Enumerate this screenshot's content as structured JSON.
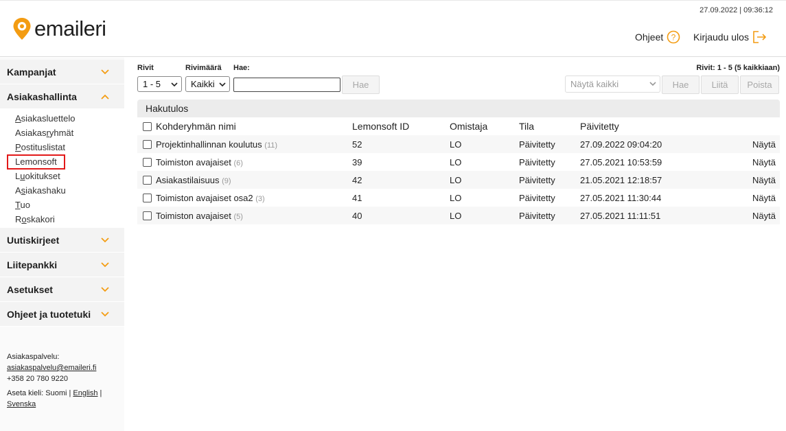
{
  "header": {
    "brand": "emaileri",
    "datetime": "27.09.2022 | 09:36:12",
    "help_label": "Ohjeet",
    "logout_label": "Kirjaudu ulos",
    "accent_color": "#f39c12"
  },
  "sidebar": {
    "sections": [
      {
        "label": "Kampanjat"
      },
      {
        "label": "Asiakashallinta"
      },
      {
        "label": "Uutiskirjeet"
      },
      {
        "label": "Liitepankki"
      },
      {
        "label": "Asetukset"
      },
      {
        "label": "Ohjeet ja tuotetuki"
      }
    ],
    "sub_items": [
      {
        "pre": "",
        "u": "A",
        "post": "siakasluettelo"
      },
      {
        "pre": "Asiakas",
        "u": "r",
        "post": "yhmät"
      },
      {
        "pre": "",
        "u": "P",
        "post": "ostituslistat"
      },
      {
        "pre": "",
        "u": "",
        "post": "Lemonsoft"
      },
      {
        "pre": "L",
        "u": "u",
        "post": "okitukset"
      },
      {
        "pre": "A",
        "u": "s",
        "post": "iakashaku"
      },
      {
        "pre": "",
        "u": "T",
        "post": "uo"
      },
      {
        "pre": "R",
        "u": "o",
        "post": "skakori"
      }
    ],
    "support": {
      "title": "Asiakaspalvelu:",
      "email": "asiakaspalvelu@emaileri.fi",
      "phone": "+358 20 780 9220",
      "lang_prefix": "Aseta kieli: Suomi |",
      "lang_en": "English",
      "lang_sep": "|",
      "lang_sv": "Svenska"
    }
  },
  "filters": {
    "rows_label": "Rivit",
    "rows_value": "1 - 5",
    "count_label": "Rivimäärä",
    "count_value": "Kaikki",
    "search_label": "Hae:",
    "search_value": "",
    "search_button": "Hae",
    "rows_info": "Rivit: 1 - 5 (5 kaikkiaan)",
    "show_select": "Näytä kaikki",
    "btn_hae": "Hae",
    "btn_liita": "Liitä",
    "btn_poista": "Poista"
  },
  "results": {
    "title": "Hakutulos",
    "columns": [
      "Kohderyhmän nimi",
      "Lemonsoft ID",
      "Omistaja",
      "Tila",
      "Päivitetty"
    ],
    "rows": [
      {
        "name": "Projektinhallinnan koulutus",
        "count": "(11)",
        "id": "52",
        "owner": "LO",
        "status": "Päivitetty",
        "updated": "27.09.2022 09:04:20",
        "action": "Näytä"
      },
      {
        "name": "Toimiston avajaiset",
        "count": "(6)",
        "id": "39",
        "owner": "LO",
        "status": "Päivitetty",
        "updated": "27.05.2021 10:53:59",
        "action": "Näytä"
      },
      {
        "name": "Asiakastilaisuus",
        "count": "(9)",
        "id": "42",
        "owner": "LO",
        "status": "Päivitetty",
        "updated": "21.05.2021 12:18:57",
        "action": "Näytä"
      },
      {
        "name": "Toimiston avajaiset osa2",
        "count": "(3)",
        "id": "41",
        "owner": "LO",
        "status": "Päivitetty",
        "updated": "27.05.2021 11:30:44",
        "action": "Näytä"
      },
      {
        "name": "Toimiston avajaiset",
        "count": "(5)",
        "id": "40",
        "owner": "LO",
        "status": "Päivitetty",
        "updated": "27.05.2021 11:11:51",
        "action": "Näytä"
      }
    ]
  }
}
